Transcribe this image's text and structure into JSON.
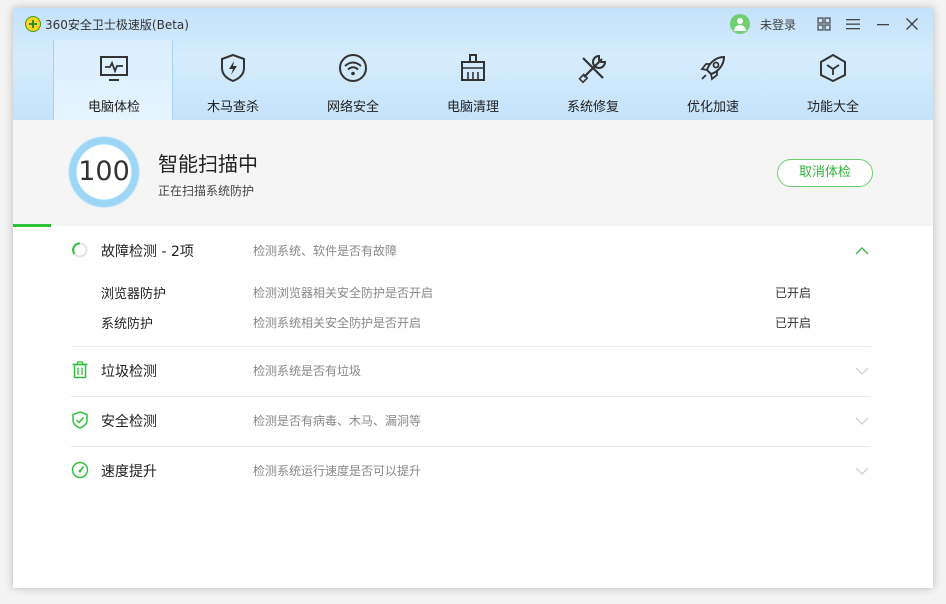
{
  "app": {
    "title": "360安全卫士极速版(Beta)"
  },
  "user": {
    "login_label": "未登录"
  },
  "nav": {
    "items": [
      {
        "label": "电脑体检",
        "icon": "monitor-pulse-icon",
        "active": true
      },
      {
        "label": "木马查杀",
        "icon": "shield-bolt-icon",
        "active": false
      },
      {
        "label": "网络安全",
        "icon": "wifi-icon",
        "active": false
      },
      {
        "label": "电脑清理",
        "icon": "broom-icon",
        "active": false
      },
      {
        "label": "系统修复",
        "icon": "wrench-screwdriver-icon",
        "active": false
      },
      {
        "label": "优化加速",
        "icon": "rocket-icon",
        "active": false
      },
      {
        "label": "功能大全",
        "icon": "cube-icon",
        "active": false
      }
    ]
  },
  "scan": {
    "score": "100",
    "title": "智能扫描中",
    "subtitle": "正在扫描系统防护",
    "cancel_label": "取消体检",
    "progress_fraction": 0.041
  },
  "categories": [
    {
      "label": "故障检测 - 2项",
      "desc": "检测系统、软件是否有故障",
      "icon": "spinner-icon",
      "expanded": true,
      "items": [
        {
          "label": "浏览器防护",
          "desc": "检测浏览器相关安全防护是否开启",
          "status": "已开启"
        },
        {
          "label": "系统防护",
          "desc": "检测系统相关安全防护是否开启",
          "status": "已开启"
        }
      ]
    },
    {
      "label": "垃圾检测",
      "desc": "检测系统是否有垃圾",
      "icon": "trash-icon",
      "expanded": false
    },
    {
      "label": "安全检测",
      "desc": "检测是否有病毒、木马、漏洞等",
      "icon": "shield-check-icon",
      "expanded": false
    },
    {
      "label": "速度提升",
      "desc": "检测系统运行速度是否可以提升",
      "icon": "speedometer-icon",
      "expanded": false
    }
  ],
  "colors": {
    "accent_green": "#2fc33c",
    "header_blue": "#c8e5fb",
    "ring_blue": "#9ed7f5"
  }
}
